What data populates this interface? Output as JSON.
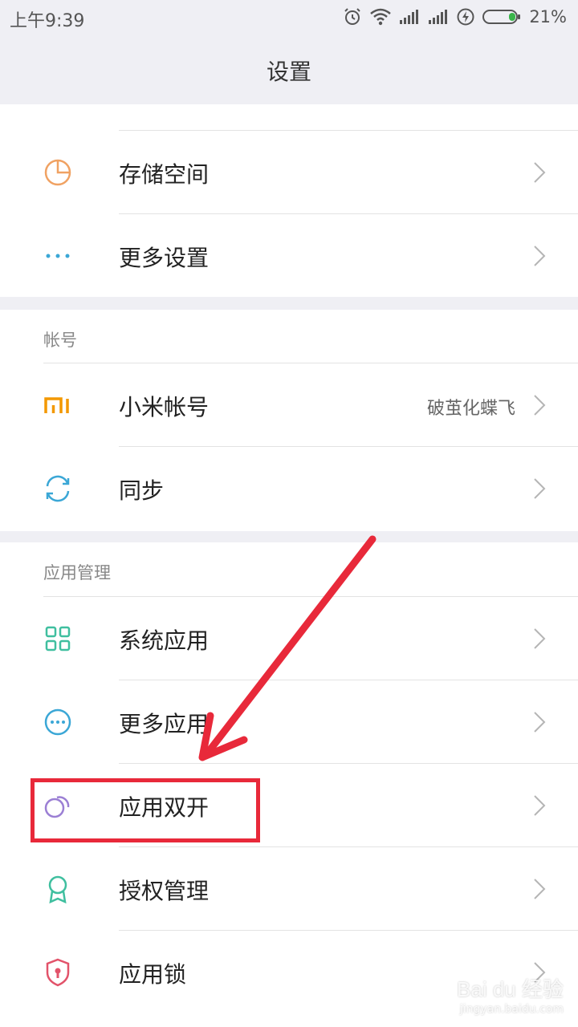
{
  "status_bar": {
    "time": "上午9:39",
    "battery_percent": "21%",
    "battery_level": 0.21,
    "icons": [
      "alarm-icon",
      "wifi-icon",
      "signal-icon",
      "signal-icon",
      "charging-icon",
      "battery-icon"
    ]
  },
  "header": {
    "title": "设置"
  },
  "group1": {
    "items": [
      {
        "label": "存储空间",
        "icon": "storage-pie-icon",
        "color": "#f0a263"
      },
      {
        "label": "更多设置",
        "icon": "more-dots-icon",
        "color": "#3ba7d6"
      }
    ]
  },
  "group2": {
    "section_title": "帐号",
    "items": [
      {
        "label": "小米帐号",
        "value": "破茧化蝶飞",
        "icon": "mi-logo-icon",
        "color": "#f39800"
      },
      {
        "label": "同步",
        "icon": "sync-icon",
        "color": "#3ba7d6"
      }
    ]
  },
  "group3": {
    "section_title": "应用管理",
    "items": [
      {
        "label": "系统应用",
        "icon": "grid-apps-icon",
        "color": "#3fbf9f"
      },
      {
        "label": "更多应用",
        "icon": "more-apps-circle-icon",
        "color": "#3ba7d6"
      },
      {
        "label": "应用双开",
        "icon": "dual-apps-icon",
        "color": "#9b7fd4"
      },
      {
        "label": "授权管理",
        "icon": "badge-icon",
        "color": "#3fbf9f"
      },
      {
        "label": "应用锁",
        "icon": "shield-lock-icon",
        "color": "#e2536a"
      }
    ]
  },
  "annotation": {
    "color": "#e8293a"
  },
  "watermark": {
    "brand": "Bai du 经验",
    "url": "jingyan.baidu.com"
  }
}
